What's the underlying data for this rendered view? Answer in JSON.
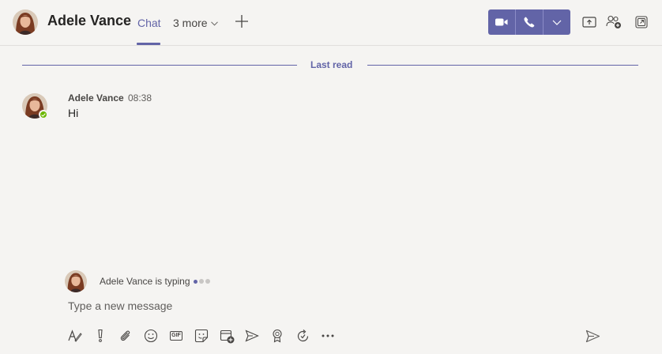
{
  "header": {
    "contact_name": "Adele Vance",
    "tabs": {
      "chat": "Chat",
      "more": "3 more"
    }
  },
  "divider": {
    "label": "Last read"
  },
  "message": {
    "author": "Adele Vance",
    "time": "08:38",
    "text": "Hi"
  },
  "typing": {
    "text": "Adele Vance is typing"
  },
  "compose": {
    "placeholder": "Type a new message"
  },
  "colors": {
    "accent": "#6264a7",
    "presence_available": "#6bb700",
    "background": "#f5f4f2"
  },
  "icons": {
    "header_actions": [
      "video-call-icon",
      "audio-call-icon",
      "chevron-down-icon",
      "share-screen-icon",
      "add-people-icon",
      "pop-out-icon"
    ],
    "toolbar": [
      "format-icon",
      "important-icon",
      "attach-icon",
      "emoji-icon",
      "gif-icon",
      "sticker-icon",
      "schedule-meeting-icon",
      "stream-icon",
      "praise-icon",
      "loop-icon",
      "more-options-icon",
      "send-icon"
    ]
  }
}
